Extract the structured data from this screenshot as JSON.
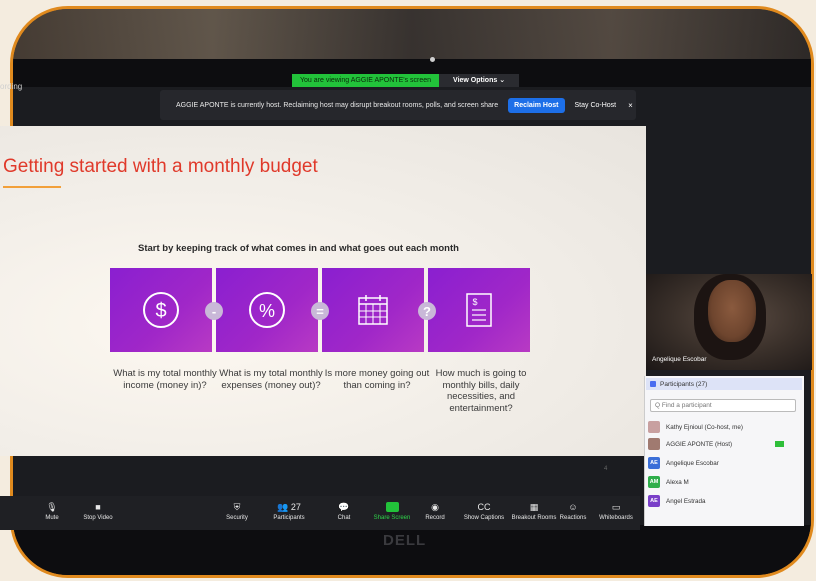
{
  "meeting": {
    "recording_label": "ording",
    "viewing_label": "You are viewing AGGIE APONTE's screen",
    "view_options_label": "View Options ⌄",
    "banner": {
      "message": "AGGIE APONTE is currently host. Reclaiming host may disrupt breakout rooms, polls, and screen share",
      "reclaim_label": "Reclaim Host",
      "stay_label": "Stay Co-Host",
      "close_glyph": "×"
    }
  },
  "slide": {
    "title": "Getting started with a monthly budget",
    "subtitle": "Start by keeping track of what comes in and what goes out each month",
    "operators": [
      "-",
      "=",
      "?"
    ],
    "captions": [
      "What is my total monthly income (money in)?",
      "What is my total monthly expenses (money out)?",
      "Is more money going out than coming in?",
      "How much is going to monthly bills, daily necessities, and entertainment?"
    ],
    "icons": [
      "dollar-icon",
      "percent-icon",
      "calendar-icon",
      "document-icon"
    ],
    "page_number": "4"
  },
  "video": {
    "name": "Angelique Escobar"
  },
  "participants": {
    "header": "Participants (27)",
    "search_placeholder": "Q Find a participant",
    "list": [
      {
        "initials": "",
        "name": "Kathy Ejnioul (Co-host, me)",
        "color": "#c8a0a0"
      },
      {
        "initials": "",
        "name": "AGGIE APONTE (Host)",
        "color": "#a07a70"
      },
      {
        "initials": "AE",
        "name": "Angelique Escobar",
        "color": "#3b6fd8"
      },
      {
        "initials": "AM",
        "name": "Alexa M",
        "color": "#2fae4a"
      },
      {
        "initials": "AE",
        "name": "Angel Estrada",
        "color": "#7a3fc8"
      }
    ]
  },
  "toolbar": {
    "items": [
      {
        "label": "Mute",
        "glyph": "🎙"
      },
      {
        "label": "Stop Video",
        "glyph": "■"
      },
      {
        "label": "Security",
        "glyph": "⛨"
      },
      {
        "label": "Participants",
        "glyph": "👥",
        "count": "27"
      },
      {
        "label": "Chat",
        "glyph": "💬"
      },
      {
        "label": "Share Screen",
        "glyph": ""
      },
      {
        "label": "Record",
        "glyph": "◉"
      },
      {
        "label": "Show Captions",
        "glyph": "CC"
      },
      {
        "label": "Breakout Rooms",
        "glyph": "▦"
      },
      {
        "label": "Reactions",
        "glyph": "☺"
      },
      {
        "label": "Whiteboards",
        "glyph": "▭"
      }
    ]
  },
  "device": {
    "brand": "DELL"
  },
  "colors": {
    "frame_border": "#e08a1e",
    "title_red": "#e0392a",
    "tile_purple": "#8a1fd0",
    "zoom_blue": "#1d6fe8",
    "zoom_green": "#22c23a"
  }
}
